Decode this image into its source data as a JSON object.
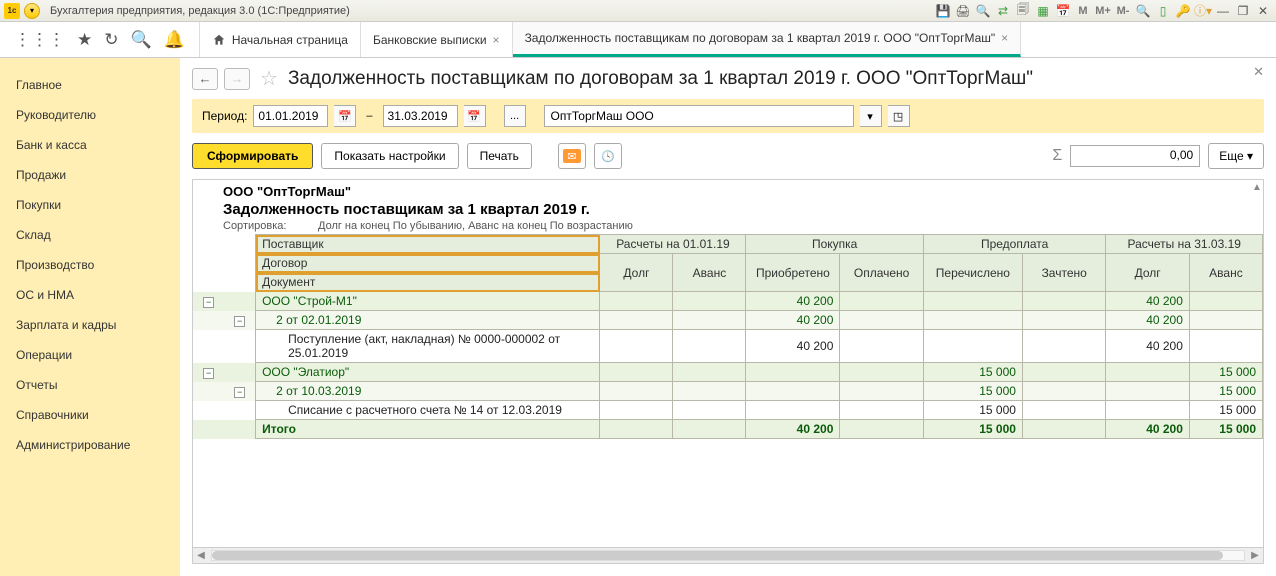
{
  "titlebar": {
    "title": "Бухгалтерия предприятия, редакция 3.0  (1С:Предприятие)"
  },
  "tabs": {
    "home": "Начальная страница",
    "t1": "Банковские выписки",
    "t2": "Задолженность поставщикам по договорам за 1 квартал 2019 г. ООО \"ОптТоргМаш\""
  },
  "sidebar": [
    "Главное",
    "Руководителю",
    "Банк и касса",
    "Продажи",
    "Покупки",
    "Склад",
    "Производство",
    "ОС и НМА",
    "Зарплата и кадры",
    "Операции",
    "Отчеты",
    "Справочники",
    "Администрирование"
  ],
  "page": {
    "title": "Задолженность поставщикам по договорам за 1 квартал 2019 г. ООО \"ОптТоргМаш\""
  },
  "filter": {
    "period_label": "Период:",
    "date_from": "01.01.2019",
    "date_to": "31.03.2019",
    "dash": "–",
    "org": "ОптТоргМаш ООО",
    "ellipsis": "..."
  },
  "actions": {
    "generate": "Сформировать",
    "settings": "Показать настройки",
    "print": "Печать",
    "more": "Еще",
    "sum": "0,00"
  },
  "report": {
    "company": "ООО \"ОптТоргМаш\"",
    "title": "Задолженность поставщикам за 1 квартал 2019 г.",
    "sort_label": "Сортировка:",
    "sort_value": "Долг на конец По убыванию, Аванс на конец По возрастанию",
    "headers": {
      "supplier": "Поставщик",
      "contract": "Договор",
      "document": "Документ",
      "calc_start": "Расчеты на 01.01.19",
      "purchase": "Покупка",
      "prepay": "Предоплата",
      "calc_end": "Расчеты на 31.03.19",
      "debt": "Долг",
      "advance": "Аванс",
      "acquired": "Приобретено",
      "paid": "Оплачено",
      "transferred": "Перечислено",
      "credited": "Зачтено"
    },
    "rows": [
      {
        "lvl": 0,
        "name": "ООО \"Строй-М1\"",
        "acq": "40 200",
        "debt_end": "40 200"
      },
      {
        "lvl": 1,
        "name": "2 от 02.01.2019",
        "acq": "40 200",
        "debt_end": "40 200"
      },
      {
        "lvl": 2,
        "name": "Поступление (акт, накладная) № 0000-000002 от 25.01.2019",
        "acq": "40 200",
        "debt_end": "40 200"
      },
      {
        "lvl": 0,
        "name": "ООО \"Элатиор\"",
        "trans": "15 000",
        "adv_end": "15 000"
      },
      {
        "lvl": 1,
        "name": "2 от 10.03.2019",
        "trans": "15 000",
        "adv_end": "15 000"
      },
      {
        "lvl": 2,
        "name": "Списание с расчетного счета № 14 от 12.03.2019",
        "trans": "15 000",
        "adv_end": "15 000"
      }
    ],
    "total_label": "Итого",
    "totals": {
      "acq": "40 200",
      "trans": "15 000",
      "debt_end": "40 200",
      "adv_end": "15 000"
    }
  }
}
